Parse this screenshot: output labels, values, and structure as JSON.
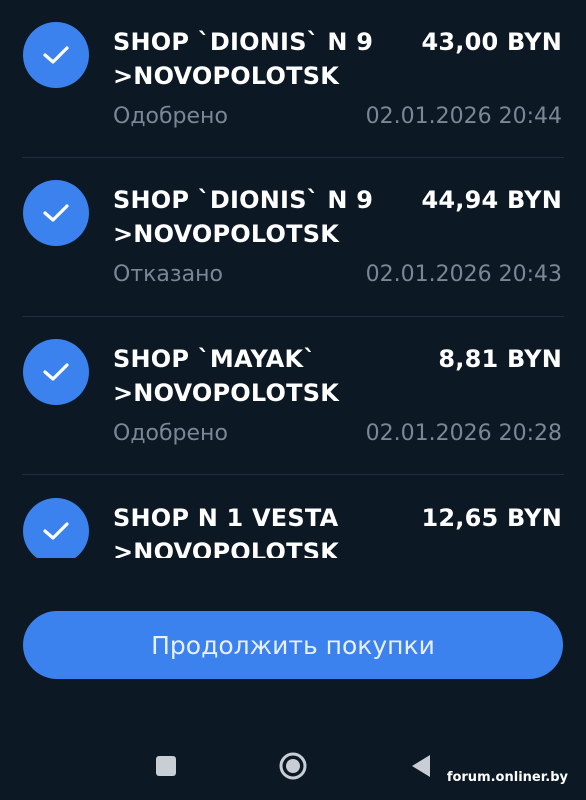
{
  "transactions": [
    {
      "merchant": "SHOP `DIONIS` N 9\n>NOVOPOLOTSK",
      "amount": "43,00 BYN",
      "status": "Одобрено",
      "datetime": "02.01.2026 20:44",
      "icon": "check-icon"
    },
    {
      "merchant": "SHOP `DIONIS` N 9\n>NOVOPOLOTSK",
      "amount": "44,94 BYN",
      "status": "Отказано",
      "datetime": "02.01.2026 20:43",
      "icon": "check-icon"
    },
    {
      "merchant": "SHOP `MAYAK`\n>NOVOPOLOTSK",
      "amount": "8,81 BYN",
      "status": "Одобрено",
      "datetime": "02.01.2026 20:28",
      "icon": "check-icon"
    },
    {
      "merchant": "SHOP N 1 VESTA\n>NOVOPOLOTSK",
      "amount": "12,65 BYN",
      "status": "",
      "datetime": "",
      "icon": "check-icon"
    }
  ],
  "continue_button": {
    "label": "Продолжить покупки"
  },
  "navbar": {
    "items": [
      "recents-icon",
      "home-icon",
      "back-icon"
    ]
  },
  "watermark": {
    "text": "forum.onliner.by"
  },
  "colors": {
    "background": "#0c1824",
    "accent": "#3b82ee",
    "muted_text": "#7b8794",
    "divider": "#1f2e3c"
  }
}
